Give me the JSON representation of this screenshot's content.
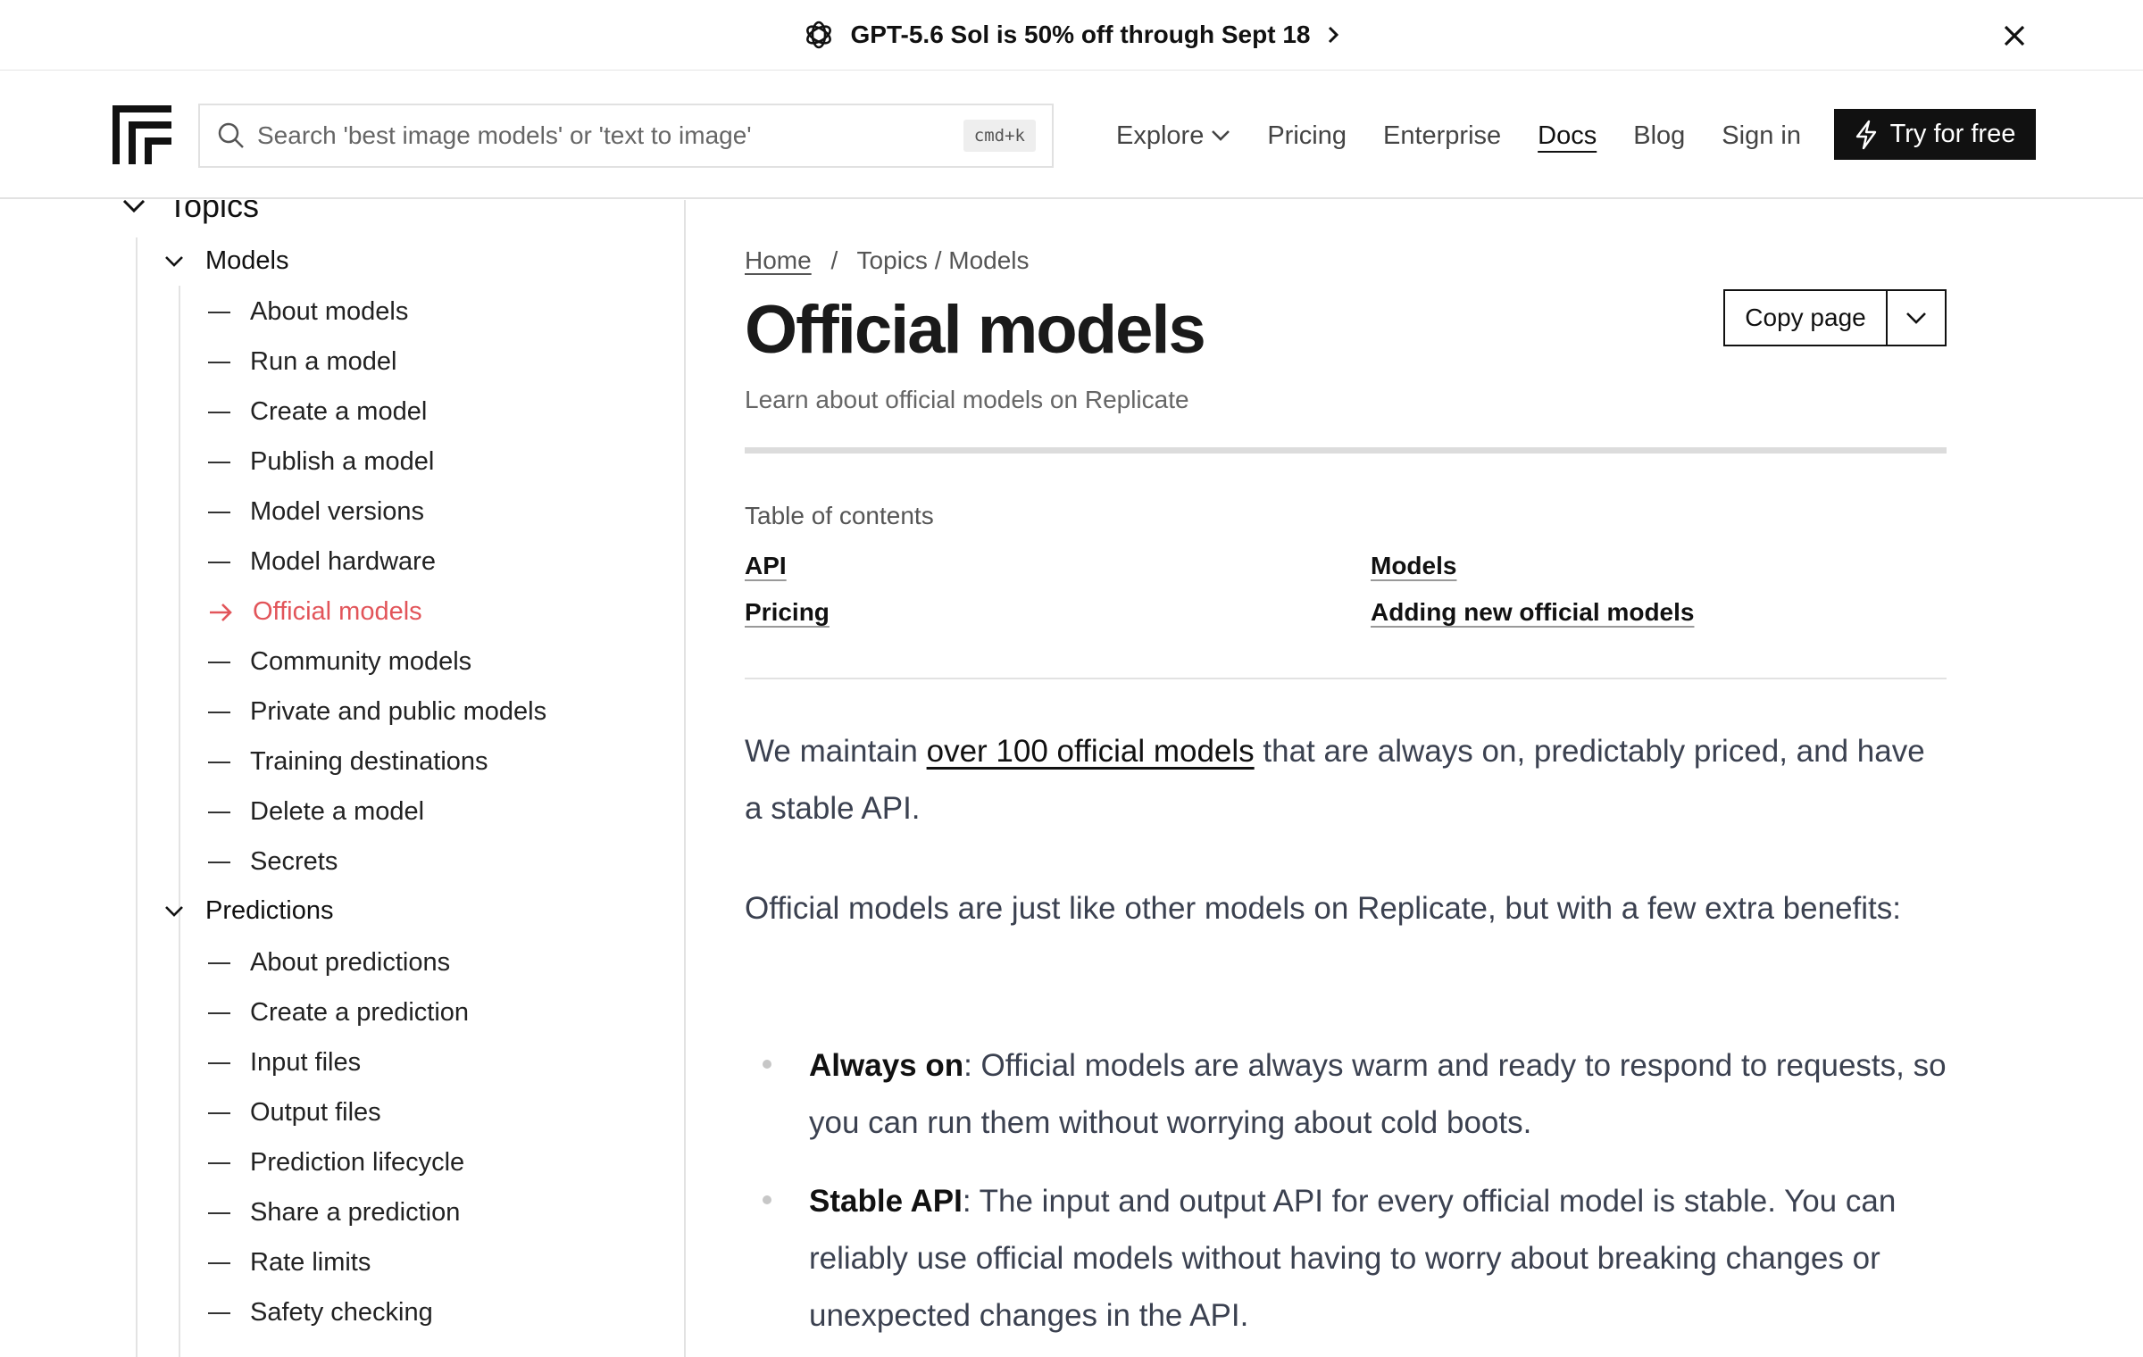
{
  "banner": {
    "text": "GPT-5.6 Sol is 50% off through Sept 18"
  },
  "header": {
    "search_placeholder": "Search 'best image models' or 'text to image'",
    "search_shortcut": "cmd+k",
    "nav": {
      "explore": "Explore",
      "pricing": "Pricing",
      "enterprise": "Enterprise",
      "docs": "Docs",
      "blog": "Blog",
      "sign_in": "Sign in"
    },
    "try_label": "Try for free"
  },
  "sidebar": {
    "section_title": "Topics",
    "groups": [
      {
        "label": "Models"
      },
      {
        "label": "Predictions"
      }
    ],
    "models_items": [
      "About models",
      "Run a model",
      "Create a model",
      "Publish a model",
      "Model versions",
      "Model hardware",
      "Official models",
      "Community models",
      "Private and public models",
      "Training destinations",
      "Delete a model",
      "Secrets"
    ],
    "active_item": "Official models",
    "predictions_items": [
      "About predictions",
      "Create a prediction",
      "Input files",
      "Output files",
      "Prediction lifecycle",
      "Share a prediction",
      "Rate limits",
      "Safety checking"
    ]
  },
  "main": {
    "breadcrumb": {
      "home": "Home",
      "separator": "/",
      "rest": "Topics / Models"
    },
    "title": "Official models",
    "subtitle": "Learn about official models on Replicate",
    "copy_label": "Copy page",
    "toc": {
      "label": "Table of contents",
      "links": [
        "API",
        "Models",
        "Pricing",
        "Adding new official models"
      ]
    },
    "intro": {
      "before": "We maintain ",
      "link": "over 100 official models",
      "after": " that are always on, predictably priced, and have a stable API."
    },
    "para2": "Official models are just like other models on Replicate, but with a few extra benefits:",
    "bullets": [
      {
        "term": "Always on",
        "text": ": Official models are always warm and ready to respond to requests, so you can run them without worrying about cold boots."
      },
      {
        "term": "Stable API",
        "text": ": The input and output API for every official model is stable. You can reliably use official models without having to worry about breaking changes or unexpected changes in the API."
      }
    ]
  },
  "colors": {
    "accent_active": "#e2555a",
    "button_dark": "#111111",
    "body_text": "#3b4150"
  }
}
